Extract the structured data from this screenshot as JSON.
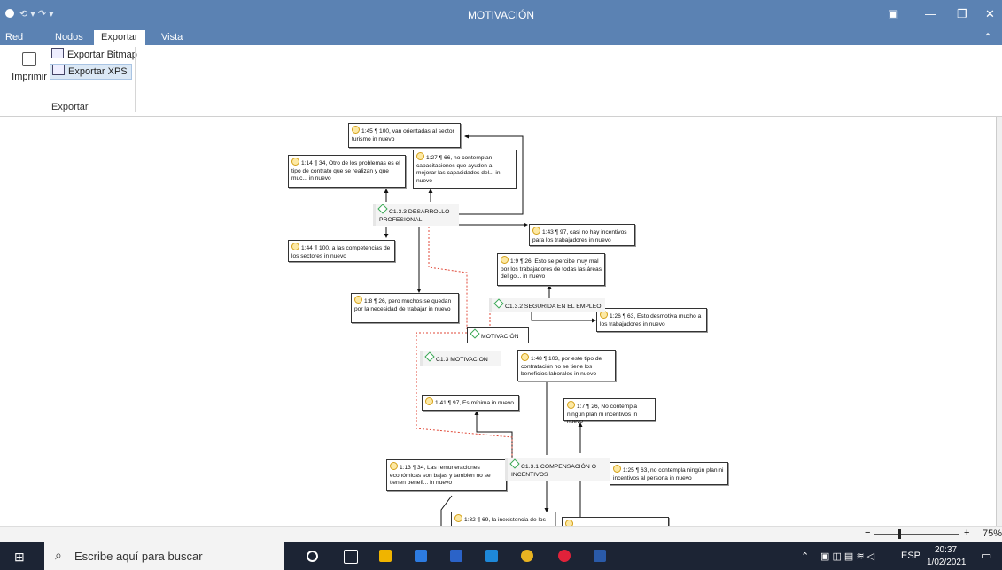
{
  "window": {
    "title": "MOTIVACIÓN",
    "qat": "⟲ ▾ ↷ ▾"
  },
  "ribbon": {
    "tabs": [
      "Red",
      "Nodos",
      "Exportar",
      "Vista"
    ],
    "print_label": "Imprimir",
    "export_bitmap": "Exportar Bitmap",
    "export_xps": "Exportar XPS",
    "group_label": "Exportar"
  },
  "network": {
    "root": "MOTIVACIÓN",
    "codes": {
      "c133": "C1.3.3 DESARROLLO PROFESIONAL",
      "c132": "C1.3.2 SEGURIDA EN EL EMPLEO",
      "c13": "C1.3 MOTIVACION",
      "c131": "C1.3.1 COMPENSACIÓN O INCENTIVOS"
    },
    "quotes": {
      "q145": "1:45 ¶ 100, van orientadas al sector turismo in nuevo",
      "q127": "1:27 ¶ 66, no contemplan capacitaciones que ayuden a mejorar las capacidades del... in nuevo",
      "q114": "1:14 ¶ 34, Otro de los problemas es el tipo de contrato que se realizan y que muc... in nuevo",
      "q143": "1:43 ¶ 97, casi no hay incentivos para los trabajadores in nuevo",
      "q144": "1:44 ¶ 100, a las competencias de los sectores in nuevo",
      "q19": "1:9 ¶ 26, Esto se percibe muy mal por los trabajadores de todas las áreas del go... in nuevo",
      "q18": "1:8 ¶ 26, pero muchos se quedan por la necesidad de trabajar in nuevo",
      "q126": "1:26 ¶ 63, Esto desmotiva mucho a los trabajadores in nuevo",
      "q148": "1:48 ¶ 103, por este tipo de contratación no se tiene los beneficios laborales in nuevo",
      "q141": "1:41 ¶ 97, Es mínima in nuevo",
      "q17": "1:7 ¶ 26, No contempla ningún plan ni incentivos in nuevo",
      "q113": "1:13 ¶ 34, Las remuneraciones económicas son bajas y también no se tienen benefi... in nuevo",
      "q125": "1:25 ¶ 63, no contempla ningún plan ni incentivos al persona in nuevo",
      "q132": "1:32 ¶ 69, la inexistencia de los"
    }
  },
  "statusbar": {
    "zoom": "75%"
  },
  "taskbar": {
    "search_placeholder": "Escribe aquí para buscar",
    "lang": "ESP",
    "time": "20:37",
    "date": "1/02/2021"
  },
  "colors": {
    "titlebar": "#5b82b3",
    "taskbar": "#1c2434",
    "link_dotted": "#e04a3a"
  }
}
